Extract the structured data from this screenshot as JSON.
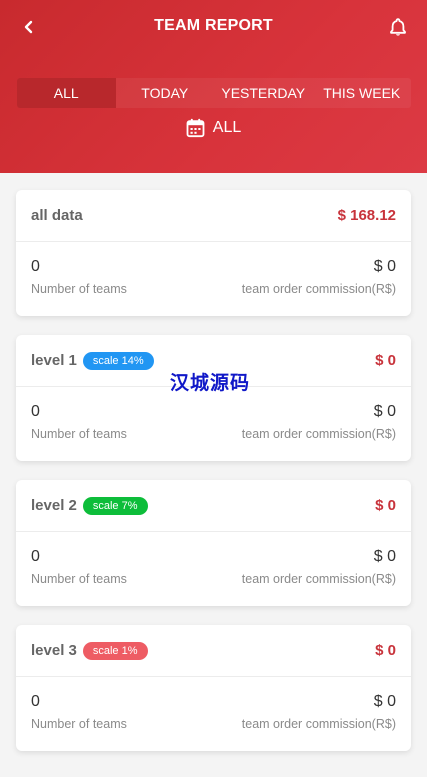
{
  "header": {
    "title": "TEAM REPORT",
    "back_icon": "chevron-left-icon",
    "bell_icon": "bell-icon"
  },
  "tabs": [
    {
      "label": "ALL",
      "active": true
    },
    {
      "label": "TODAY",
      "active": false
    },
    {
      "label": "YESTERDAY",
      "active": false
    },
    {
      "label": "THIS WEEK",
      "active": false
    }
  ],
  "date_filter": {
    "icon": "calendar-icon",
    "label": "ALL"
  },
  "cards": [
    {
      "title": "all data",
      "badge": null,
      "badge_color": null,
      "amount": "$ 168.12",
      "teams_value": "0",
      "teams_label": "Number of teams",
      "commission_value": "$ 0",
      "commission_label": "team order commission(R$)"
    },
    {
      "title": "level 1",
      "badge": "scale 14%",
      "badge_color": "#2196f3",
      "amount": "$ 0",
      "teams_value": "0",
      "teams_label": "Number of teams",
      "commission_value": "$ 0",
      "commission_label": "team order commission(R$)"
    },
    {
      "title": "level 2",
      "badge": "scale 7%",
      "badge_color": "#0dbd3a",
      "amount": "$ 0",
      "teams_value": "0",
      "teams_label": "Number of teams",
      "commission_value": "$ 0",
      "commission_label": "team order commission(R$)"
    },
    {
      "title": "level 3",
      "badge": "scale 1%",
      "badge_color": "#ee5c64",
      "amount": "$ 0",
      "teams_value": "0",
      "teams_label": "Number of teams",
      "commission_value": "$ 0",
      "commission_label": "team order commission(R$)"
    }
  ],
  "watermark": "汉城源码",
  "colors": {
    "header": "#d12f36",
    "accent": "#c8333b"
  }
}
